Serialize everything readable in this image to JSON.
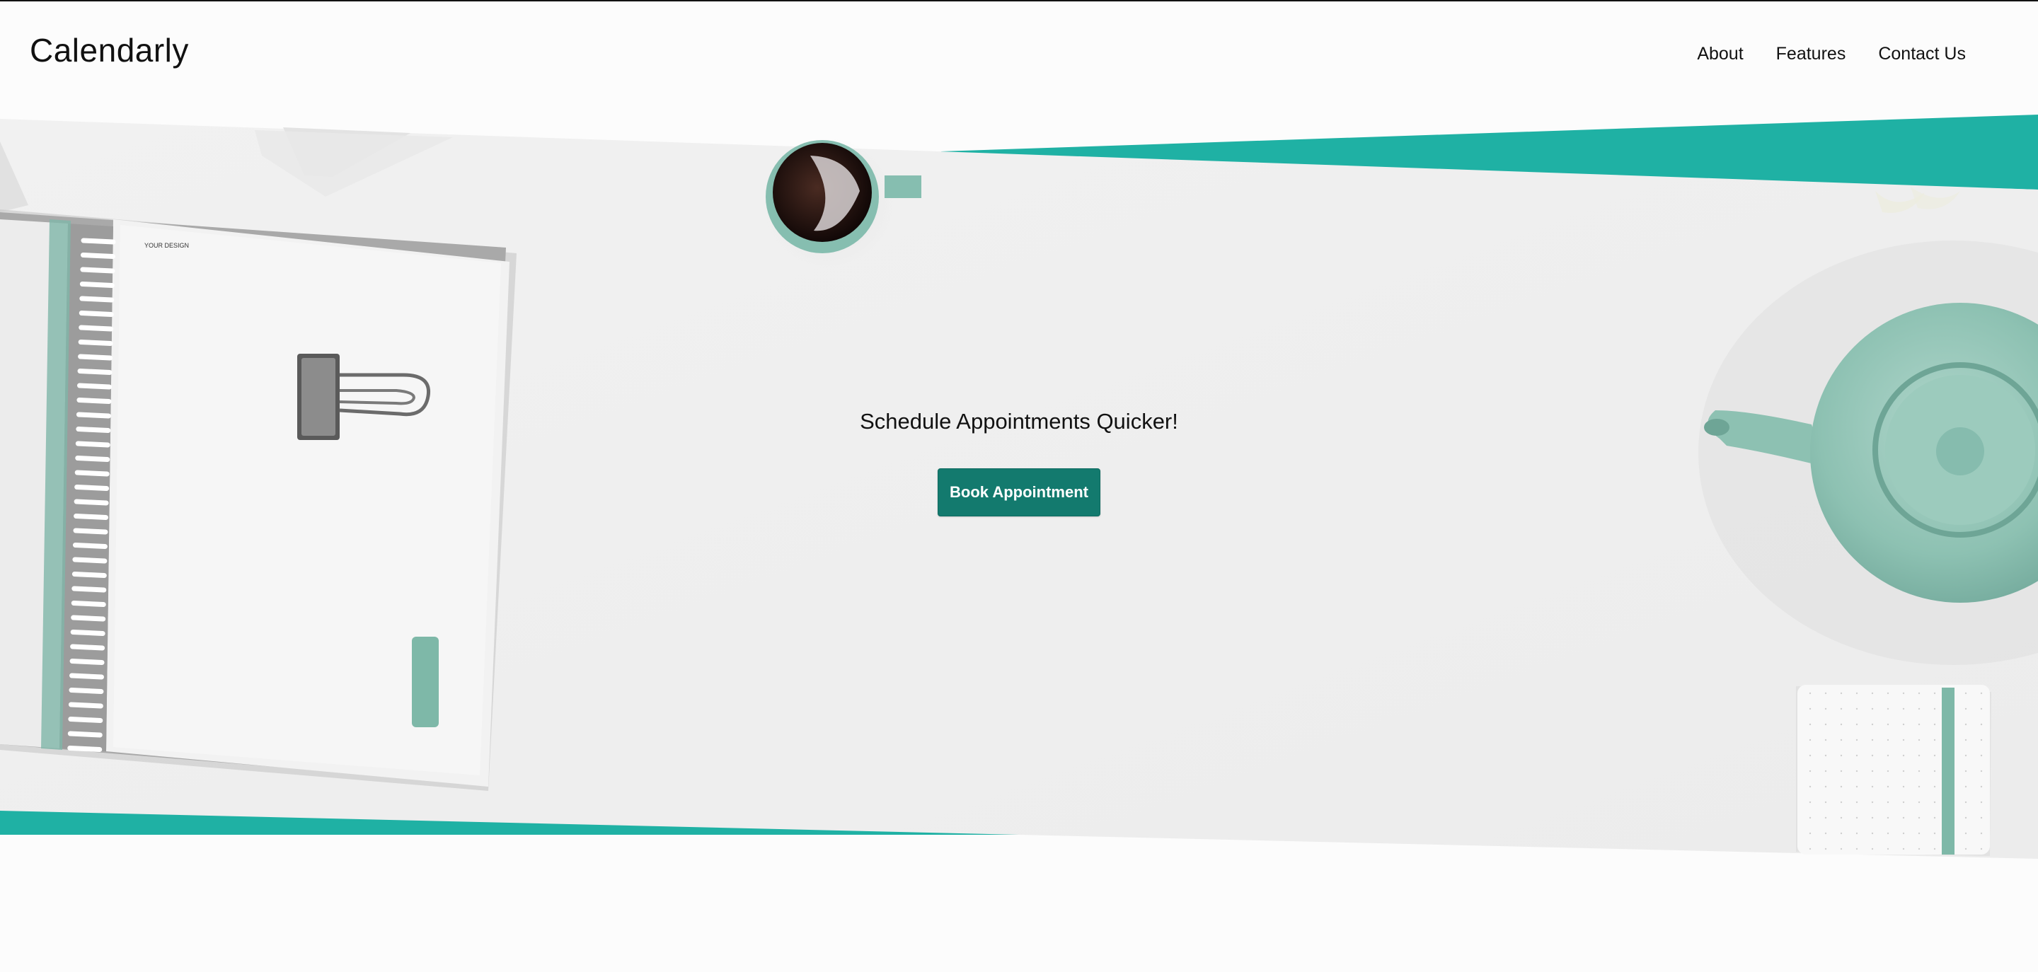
{
  "header": {
    "brand": "Calendarly",
    "nav": [
      "About",
      "Features",
      "Contact Us"
    ]
  },
  "hero": {
    "headline": "Schedule Appointments Quicker!",
    "cta_label": "Book Appointment",
    "notebook_cover_text": "YOUR DESIGN"
  },
  "colors": {
    "accent_teal": "#1fb1a4",
    "button": "#137a6e",
    "mint": "#86beb0",
    "background": "#fcfcfc",
    "hero_surface": "#efefef"
  },
  "icons": [
    "coffee-cup-icon",
    "teapot-icon",
    "binder-clip-icon"
  ]
}
